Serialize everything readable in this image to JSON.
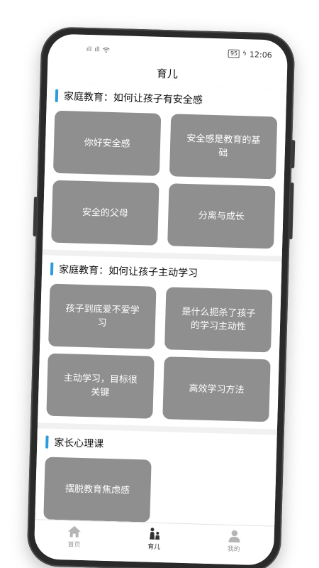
{
  "status_bar": {
    "signal1": "ıll",
    "signal2": "ıll",
    "battery": "95",
    "time": "12:06"
  },
  "header": {
    "title": "育儿"
  },
  "sections": [
    {
      "title": "家庭教育：如何让孩子有安全感",
      "cards": [
        "你好安全感",
        "安全感是教育的基础",
        "安全的父母",
        "分离与成长"
      ]
    },
    {
      "title": "家庭教育：如何让孩子主动学习",
      "cards": [
        "孩子到底爱不爱学习",
        "是什么扼杀了孩子的学习主动性",
        "主动学习，目标很关键",
        "高效学习方法"
      ]
    },
    {
      "title": "家长心理课",
      "cards": [
        "摆脱教育焦虑感"
      ]
    }
  ],
  "tab_bar": {
    "items": [
      {
        "label": "首页",
        "icon": "home-icon"
      },
      {
        "label": "育儿",
        "icon": "parent-child-icon"
      },
      {
        "label": "我的",
        "icon": "user-icon"
      }
    ]
  },
  "colors": {
    "accent": "#2d9cdb",
    "card": "#8f8f8f"
  }
}
